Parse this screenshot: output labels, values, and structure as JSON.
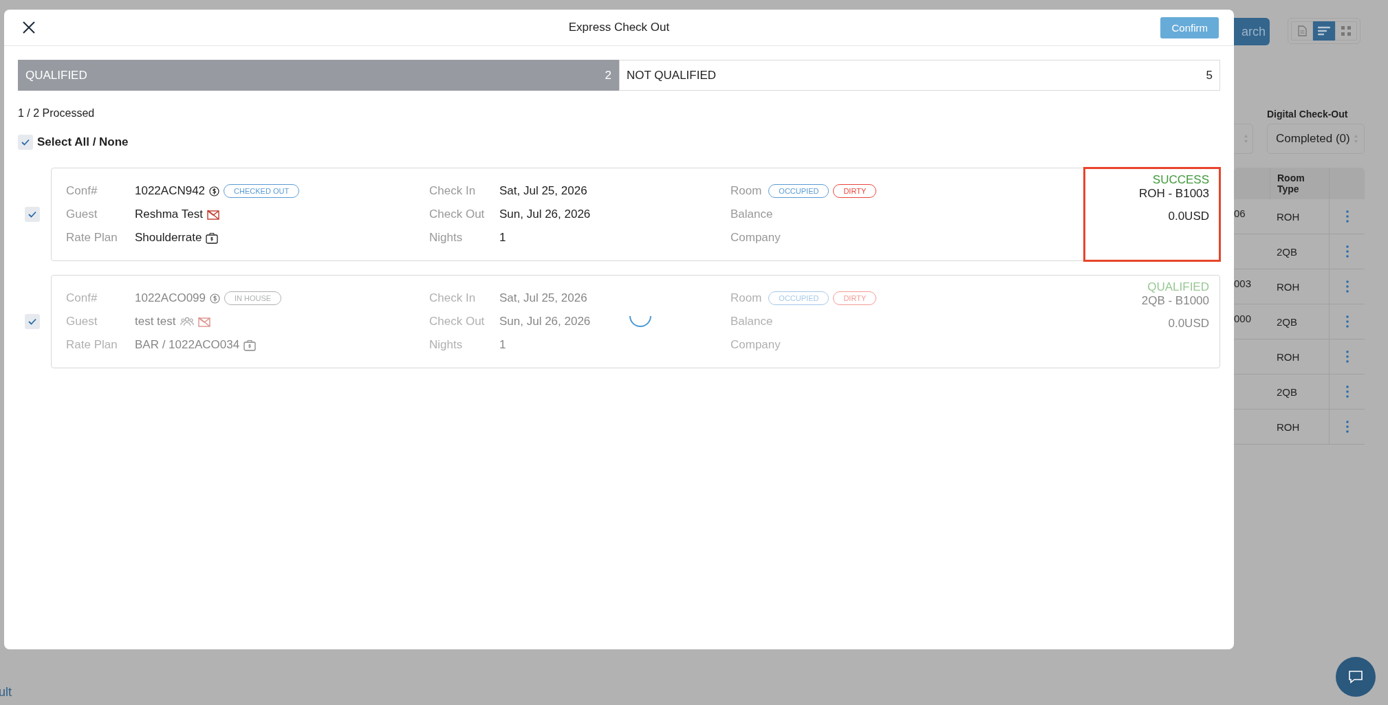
{
  "background": {
    "search_button": "arch",
    "view_toggle": [
      {
        "kind": "document",
        "selected": false
      },
      {
        "kind": "list",
        "selected": true
      },
      {
        "kind": "grid",
        "selected": false
      }
    ],
    "filter_label": "Digital Check-Out",
    "filter_value": "Completed (0)",
    "table": {
      "columns": [
        "Room Type"
      ],
      "rows": [
        {
          "column_1": "06",
          "room_type": "ROH"
        },
        {
          "room_type": "2QB"
        },
        {
          "column_1": "003",
          "room_type": "ROH"
        },
        {
          "column_1": "000",
          "room_type": "2QB"
        },
        {
          "room_type": "ROH"
        },
        {
          "room_type": "2QB"
        },
        {
          "room_type": "ROH"
        }
      ]
    },
    "footer_link": "ult"
  },
  "window": {
    "title": "Express Check Out"
  },
  "confirm_button": "Confirm",
  "tabs": [
    {
      "label": "QUALIFIED",
      "count": "2",
      "selected": true
    },
    {
      "label": "NOT QUALIFIED",
      "count": "5",
      "selected": false
    }
  ],
  "progress_text": "1 / 2 Processed",
  "select_all": {
    "label": "Select All / None",
    "checked": true
  },
  "reservations": [
    {
      "checked": true,
      "faded": false,
      "loading": false,
      "highlighted": true,
      "conf_label": "Conf#",
      "conf": "1022ACN942",
      "conf_status": {
        "label": "CHECKED OUT",
        "kind": "checked_out"
      },
      "guest_label": "Guest",
      "guest": "Reshma Test",
      "group": false,
      "mail_blocked": true,
      "rate_plan_label": "Rate Plan",
      "rate_plan": "Shoulderrate",
      "check_in_label": "Check In",
      "check_in": "Sat, Jul 25, 2026",
      "check_out_label": "Check Out",
      "check_out": "Sun, Jul 26, 2026",
      "nights_label": "Nights",
      "nights": "1",
      "room_label": "Room",
      "room_tags": [
        {
          "label": "OCCUPIED",
          "kind": "occupied"
        },
        {
          "label": "DIRTY",
          "kind": "dirty"
        }
      ],
      "balance_label": "Balance",
      "company_label": "Company",
      "result": "SUCCESS",
      "room": "ROH - B1003",
      "balance": "0.0USD"
    },
    {
      "checked": true,
      "faded": true,
      "loading": true,
      "highlighted": false,
      "conf_label": "Conf#",
      "conf": "1022ACO099",
      "conf_status": {
        "label": "IN HOUSE",
        "kind": "in_house"
      },
      "guest_label": "Guest",
      "guest": "test test",
      "group": true,
      "mail_blocked": true,
      "rate_plan_label": "Rate Plan",
      "rate_plan": "BAR / 1022ACO034",
      "check_in_label": "Check In",
      "check_in": "Sat, Jul 25, 2026",
      "check_out_label": "Check Out",
      "check_out": "Sun, Jul 26, 2026",
      "nights_label": "Nights",
      "nights": "1",
      "room_label": "Room",
      "room_tags": [
        {
          "label": "OCCUPIED",
          "kind": "occupied"
        },
        {
          "label": "DIRTY",
          "kind": "dirty"
        }
      ],
      "balance_label": "Balance",
      "company_label": "Company",
      "result": "QUALIFIED",
      "room": "2QB - B1000",
      "balance": "0.0USD"
    }
  ]
}
